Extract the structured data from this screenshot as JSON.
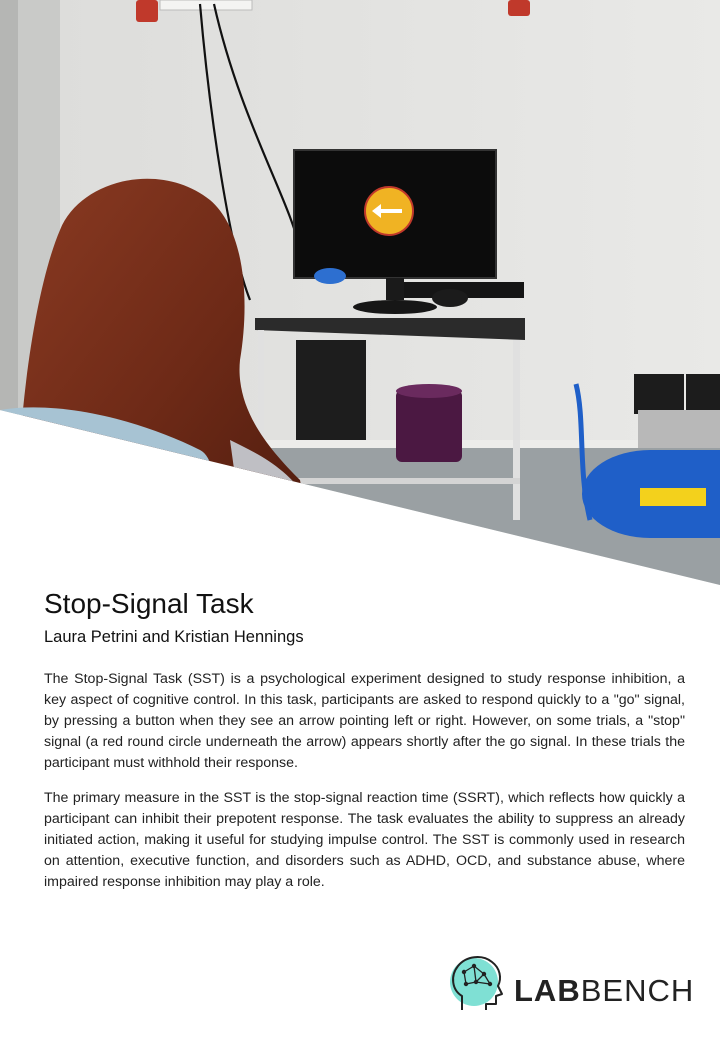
{
  "title": "Stop-Signal Task",
  "authors": "Laura Petrini and Kristian Hennings",
  "paragraphs": [
    "The Stop-Signal Task (SST) is a psychological experiment designed to study response inhibition, a key aspect of cognitive control. In this task, participants are asked to respond quickly to a \"go\" signal, by pressing a button when they see an arrow pointing left or right. However, on some trials, a \"stop\" signal (a red round circle underneath the arrow) appears shortly after the go signal. In these trials the participant must withhold their response.",
    "The primary measure in the SST is the stop-signal reaction time (SSRT), which reflects how quickly a participant can inhibit their prepotent response. The task evaluates the ability to suppress an already initiated action, making it useful for studying impulse control. The SST is commonly used in research on attention, executive function, and disorders such as ADHD, OCD, and substance abuse, where impaired response inhibition may play a role."
  ],
  "logo": {
    "lab": "LAB",
    "bench": "BENCH"
  },
  "photo": {
    "stimulus_icon": "left-arrow-icon",
    "stimulus_color": "#f0b323",
    "stop_ring_color": "#c0392b"
  },
  "colors": {
    "logo_accent": "#7fe0d4",
    "compressor_blue": "#1f5fc8"
  }
}
